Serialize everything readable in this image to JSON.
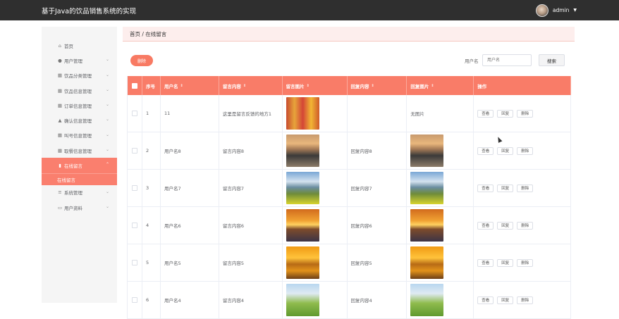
{
  "app": {
    "title": "基于Java的饮品销售系统的实现",
    "user": "admin"
  },
  "sidebar": {
    "items": [
      {
        "label": "首页",
        "icon": "home-icon"
      },
      {
        "label": "用户管理",
        "icon": "user-icon"
      },
      {
        "label": "饮品分类管理",
        "icon": "grid-icon"
      },
      {
        "label": "饮品信息管理",
        "icon": "grid-icon"
      },
      {
        "label": "订单信息管理",
        "icon": "grid-icon"
      },
      {
        "label": "确认信息管理",
        "icon": "person-icon"
      },
      {
        "label": "叫号信息管理",
        "icon": "grid-icon"
      },
      {
        "label": "取餐信息管理",
        "icon": "grid-icon"
      },
      {
        "label": "在线留言",
        "icon": "chart-icon"
      },
      {
        "label": "系统管理",
        "icon": "list-icon"
      },
      {
        "label": "用户资料",
        "icon": "calendar-icon"
      }
    ],
    "submenu": "在线留言"
  },
  "breadcrumb": "首页 / 在线留言",
  "toolbar": {
    "delete": "删除",
    "search_label": "用户名",
    "search_placeholder": "用户名",
    "search_button": "搜索"
  },
  "table": {
    "headers": [
      "序号",
      "用户名",
      "留言内容",
      "留言图片",
      "回复内容",
      "回复图片",
      "操作"
    ],
    "rows": [
      {
        "index": "1",
        "user": "11",
        "msg": "这里是留言反馈的地方1",
        "reply": "",
        "reply_img": "无图片",
        "img": "juice"
      },
      {
        "index": "2",
        "user": "用户名8",
        "msg": "留言内容8",
        "reply": "回复内容8",
        "reply_img": "",
        "img": "beach"
      },
      {
        "index": "3",
        "user": "用户名7",
        "msg": "留言内容7",
        "reply": "回复内容7",
        "reply_img": "",
        "img": "mount"
      },
      {
        "index": "4",
        "user": "用户名6",
        "msg": "留言内容6",
        "reply": "回复内容6",
        "reply_img": "",
        "img": "sunset"
      },
      {
        "index": "5",
        "user": "用户名5",
        "msg": "留言内容5",
        "reply": "回复内容5",
        "reply_img": "",
        "img": "lake"
      },
      {
        "index": "6",
        "user": "用户名4",
        "msg": "留言内容4",
        "reply": "回复内容4",
        "reply_img": "",
        "img": "hill"
      }
    ],
    "ops": [
      "查看",
      "回复",
      "删除"
    ]
  },
  "colors": {
    "accent": "#f97c68",
    "topbar": "#2f2f2f"
  }
}
